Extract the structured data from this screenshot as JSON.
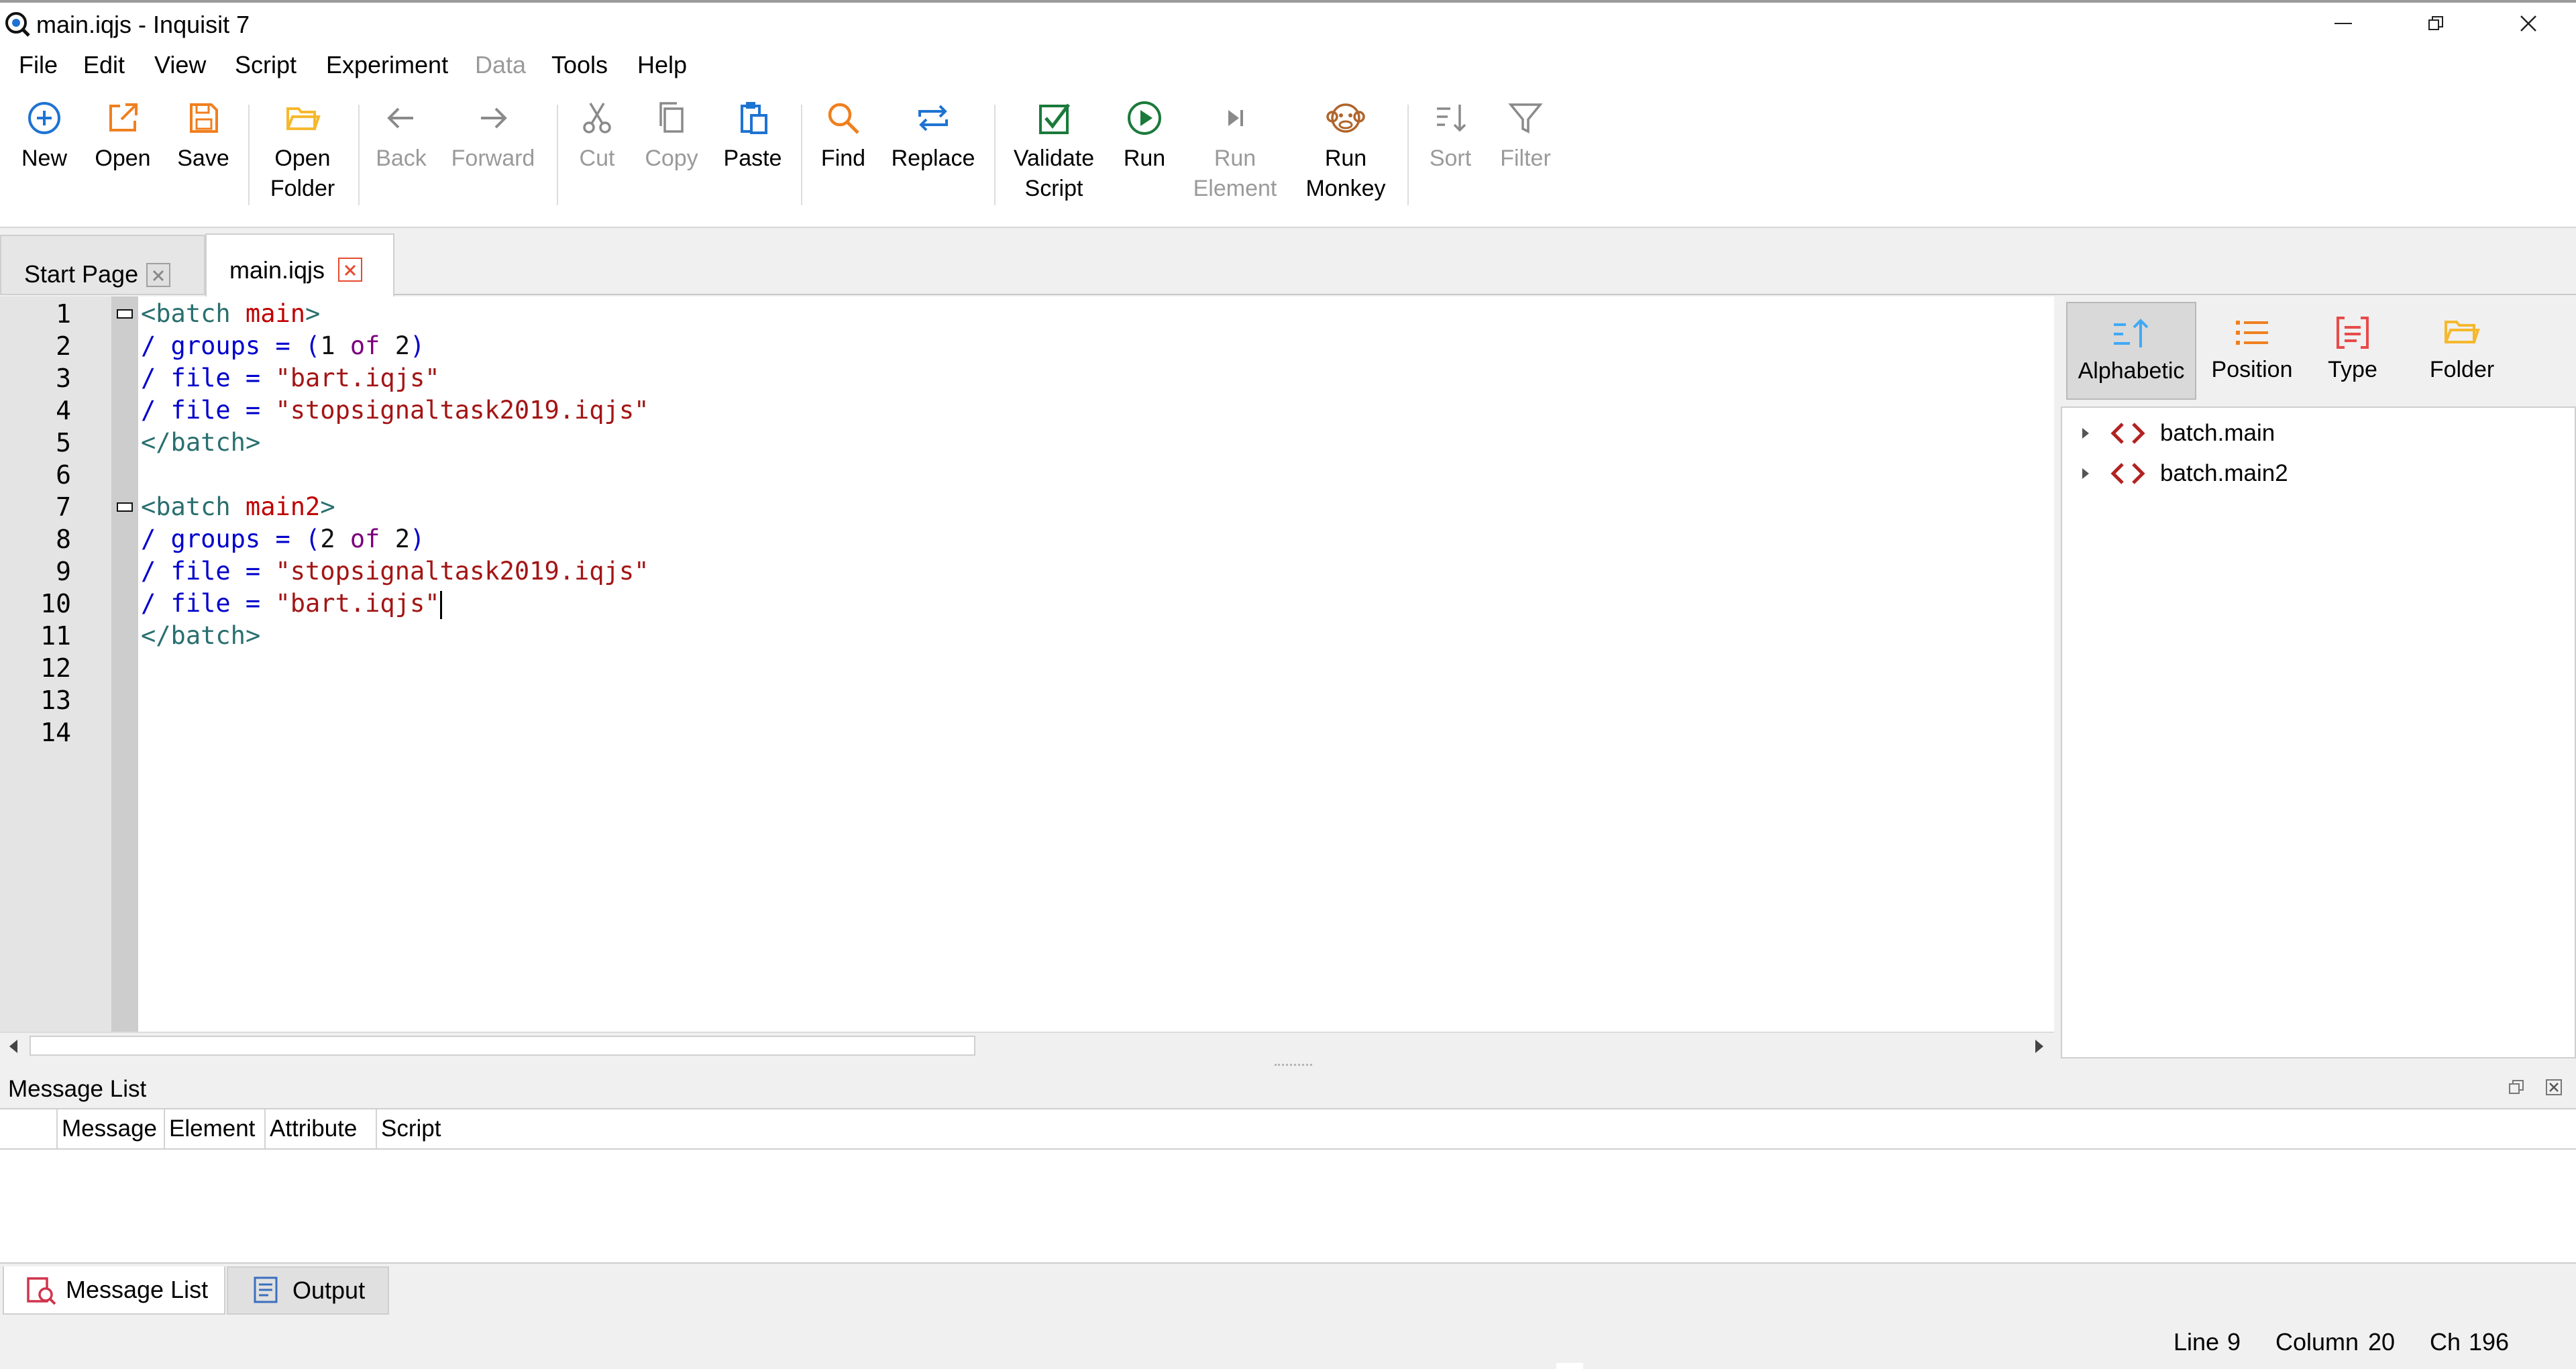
{
  "window": {
    "title": "main.iqjs - Inquisit 7"
  },
  "menu": [
    {
      "label": "File",
      "disabled": false
    },
    {
      "label": "Edit",
      "disabled": false
    },
    {
      "label": "View",
      "disabled": false
    },
    {
      "label": "Script",
      "disabled": false
    },
    {
      "label": "Experiment",
      "disabled": false
    },
    {
      "label": "Data",
      "disabled": true
    },
    {
      "label": "Tools",
      "disabled": false
    },
    {
      "label": "Help",
      "disabled": false
    }
  ],
  "toolbar": {
    "new": "New",
    "open": "Open",
    "save": "Save",
    "open_folder_1": "Open",
    "open_folder_2": "Folder",
    "back": "Back",
    "forward": "Forward",
    "cut": "Cut",
    "copy": "Copy",
    "paste": "Paste",
    "find": "Find",
    "replace": "Replace",
    "validate_1": "Validate",
    "validate_2": "Script",
    "run": "Run",
    "run_element_1": "Run",
    "run_element_2": "Element",
    "run_monkey_1": "Run",
    "run_monkey_2": "Monkey",
    "sort": "Sort",
    "filter": "Filter"
  },
  "tabs": [
    {
      "label": "Start Page",
      "active": false
    },
    {
      "label": "main.iqjs",
      "active": true
    }
  ],
  "editor": {
    "line_numbers": [
      "1",
      "2",
      "3",
      "4",
      "5",
      "6",
      "7",
      "8",
      "9",
      "10",
      "11",
      "12",
      "13",
      "14"
    ],
    "lines": [
      "<batch main>",
      "/ groups = (1 of 2)",
      "/ file = \"bart.iqjs\"",
      "/ file = \"stopsignaltask2019.iqjs\"",
      "</batch>",
      "",
      "<batch main2>",
      "/ groups = (2 of 2)",
      "/ file = \"stopsignaltask2019.iqjs\"",
      "/ file = \"bart.iqjs\"",
      "</batch>",
      "",
      "",
      ""
    ]
  },
  "colors": {
    "tag": "#2a6f6f",
    "name": "#c00000",
    "attr": "#0000cc",
    "string": "#a31515",
    "keyword": "#7b007b",
    "accent_blue": "#1e73d2",
    "accent_orange": "#f07f1e",
    "accent_green": "#1a7a3a"
  },
  "right_panel": {
    "buttons": {
      "alphabetic": "Alphabetic",
      "position": "Position",
      "type": "Type",
      "folder": "Folder"
    },
    "tree": [
      "batch.main",
      "batch.main2"
    ]
  },
  "message_list": {
    "title": "Message List",
    "columns": {
      "message": "Message",
      "element": "Element",
      "attribute": "Attribute",
      "script": "Script"
    }
  },
  "bottom_tabs": {
    "message_list": "Message List",
    "output": "Output"
  },
  "status": {
    "line_label": "Line",
    "line": "9",
    "column_label": "Column",
    "column": "20",
    "ch_label": "Ch",
    "ch": "196"
  }
}
